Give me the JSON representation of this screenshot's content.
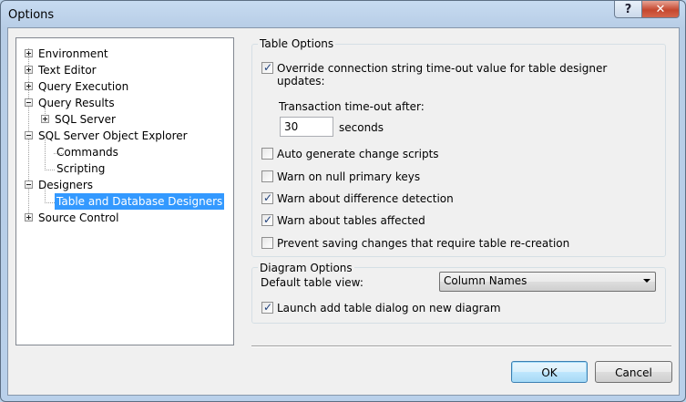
{
  "window": {
    "title": "Options",
    "help_glyph": "?",
    "close_glyph": "✕"
  },
  "tree": {
    "items": [
      {
        "label": "Environment",
        "expander": "plus"
      },
      {
        "label": "Text Editor",
        "expander": "plus"
      },
      {
        "label": "Query Execution",
        "expander": "plus"
      },
      {
        "label": "Query Results",
        "expander": "minus"
      },
      {
        "label": "SQL Server",
        "expander": "plus"
      },
      {
        "label": "SQL Server Object Explorer",
        "expander": "minus"
      },
      {
        "label": "Commands",
        "expander": "none"
      },
      {
        "label": "Scripting",
        "expander": "none"
      },
      {
        "label": "Designers",
        "expander": "minus"
      },
      {
        "label": "Table and Database Designers",
        "expander": "none",
        "selected": true
      },
      {
        "label": "Source Control",
        "expander": "plus"
      }
    ]
  },
  "table_options": {
    "title": "Table Options",
    "override_timeout": {
      "label_line1": "Override connection string time-out value for table designer",
      "label_line2": "updates:",
      "checked": true
    },
    "transaction_timeout": {
      "label": "Transaction time-out after:",
      "value": "30",
      "unit": "seconds"
    },
    "checkboxes": [
      {
        "label": "Auto generate change scripts",
        "checked": false
      },
      {
        "label": "Warn on null primary keys",
        "checked": false
      },
      {
        "label": "Warn about difference detection",
        "checked": true
      },
      {
        "label": "Warn about tables affected",
        "checked": true
      },
      {
        "label": "Prevent saving changes that require table re-creation",
        "checked": false
      }
    ]
  },
  "diagram_options": {
    "title": "Diagram Options",
    "default_view_label": "Default table view:",
    "default_view_value": "Column Names",
    "launch_add_table": {
      "label": "Launch add table dialog on new diagram",
      "checked": true
    }
  },
  "buttons": {
    "ok": "OK",
    "cancel": "Cancel"
  }
}
